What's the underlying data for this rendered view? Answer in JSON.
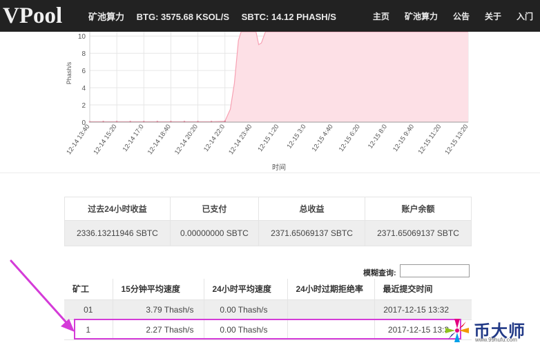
{
  "header": {
    "logo": "VPool",
    "hashrate_title": "矿池算力",
    "btg": "BTG: 3575.68 KSOL/S",
    "sbtc": "SBTC: 14.12 PHASH/S",
    "nav": [
      "主页",
      "矿池算力",
      "公告",
      "关于",
      "入门"
    ]
  },
  "chart_data": {
    "type": "area",
    "ylabel": "Phash/s",
    "xlabel": "时间",
    "yticks": [
      0,
      2,
      4,
      6,
      8,
      10
    ],
    "ylim": [
      0,
      10.5
    ],
    "xticks": [
      "12-14 13:40",
      "12-14 15:20",
      "12-14 17:0",
      "12-14 18:40",
      "12-14 20:20",
      "12-14 22:0",
      "12-14 23:40",
      "12-15 1:20",
      "12-15 3:0",
      "12-15 4:40",
      "12-15 6:20",
      "12-15 8:0",
      "12-15 9:40",
      "12-15 11:20",
      "12-15 13:20"
    ],
    "grid": true,
    "color": "#f7a1b3",
    "fill": "#fde0e6",
    "points": [
      [
        0,
        0.05
      ],
      [
        0.5,
        0.05
      ],
      [
        1,
        0.05
      ],
      [
        1.5,
        0.05
      ],
      [
        2,
        0.05
      ],
      [
        2.5,
        0.05
      ],
      [
        3,
        0.05
      ],
      [
        3.5,
        0.05
      ],
      [
        4,
        0.05
      ],
      [
        4.5,
        0.05
      ],
      [
        5,
        0.1
      ],
      [
        5.2,
        1.5
      ],
      [
        5.35,
        4.5
      ],
      [
        5.5,
        9.5
      ],
      [
        5.6,
        12
      ],
      [
        6,
        12
      ],
      [
        6.15,
        11.5
      ],
      [
        6.25,
        9.0
      ],
      [
        6.35,
        9.2
      ],
      [
        6.5,
        11.5
      ],
      [
        6.7,
        12
      ],
      [
        7,
        12
      ],
      [
        8,
        12
      ],
      [
        9,
        12
      ],
      [
        10,
        12
      ],
      [
        11,
        12
      ],
      [
        12,
        12
      ],
      [
        13,
        12
      ],
      [
        14,
        12
      ]
    ]
  },
  "earnings": {
    "headers": [
      "过去24小时收益",
      "已支付",
      "总收益",
      "账户余额"
    ],
    "values": [
      "2336.13211946 SBTC",
      "0.00000000 SBTC",
      "2371.65069137 SBTC",
      "2371.65069137 SBTC"
    ]
  },
  "search": {
    "label": "模糊查询:",
    "value": ""
  },
  "workers": {
    "headers": [
      "矿工",
      "15分钟平均速度",
      "24小时平均速度",
      "24小时过期拒绝率",
      "最近提交时间"
    ],
    "rows": [
      [
        "01",
        "3.79 Thash/s",
        "0.00 Thash/s",
        "",
        "2017-12-15 13:32"
      ],
      [
        "1",
        "2.27 Thash/s",
        "0.00 Thash/s",
        "",
        "2017-12-15 13:3"
      ]
    ]
  },
  "watermark": {
    "text": "币大师",
    "url": "www.99hufu.com"
  },
  "colors": {
    "navbar": "#222222",
    "annotation": "#d43bd8",
    "brand": "#223a87"
  }
}
